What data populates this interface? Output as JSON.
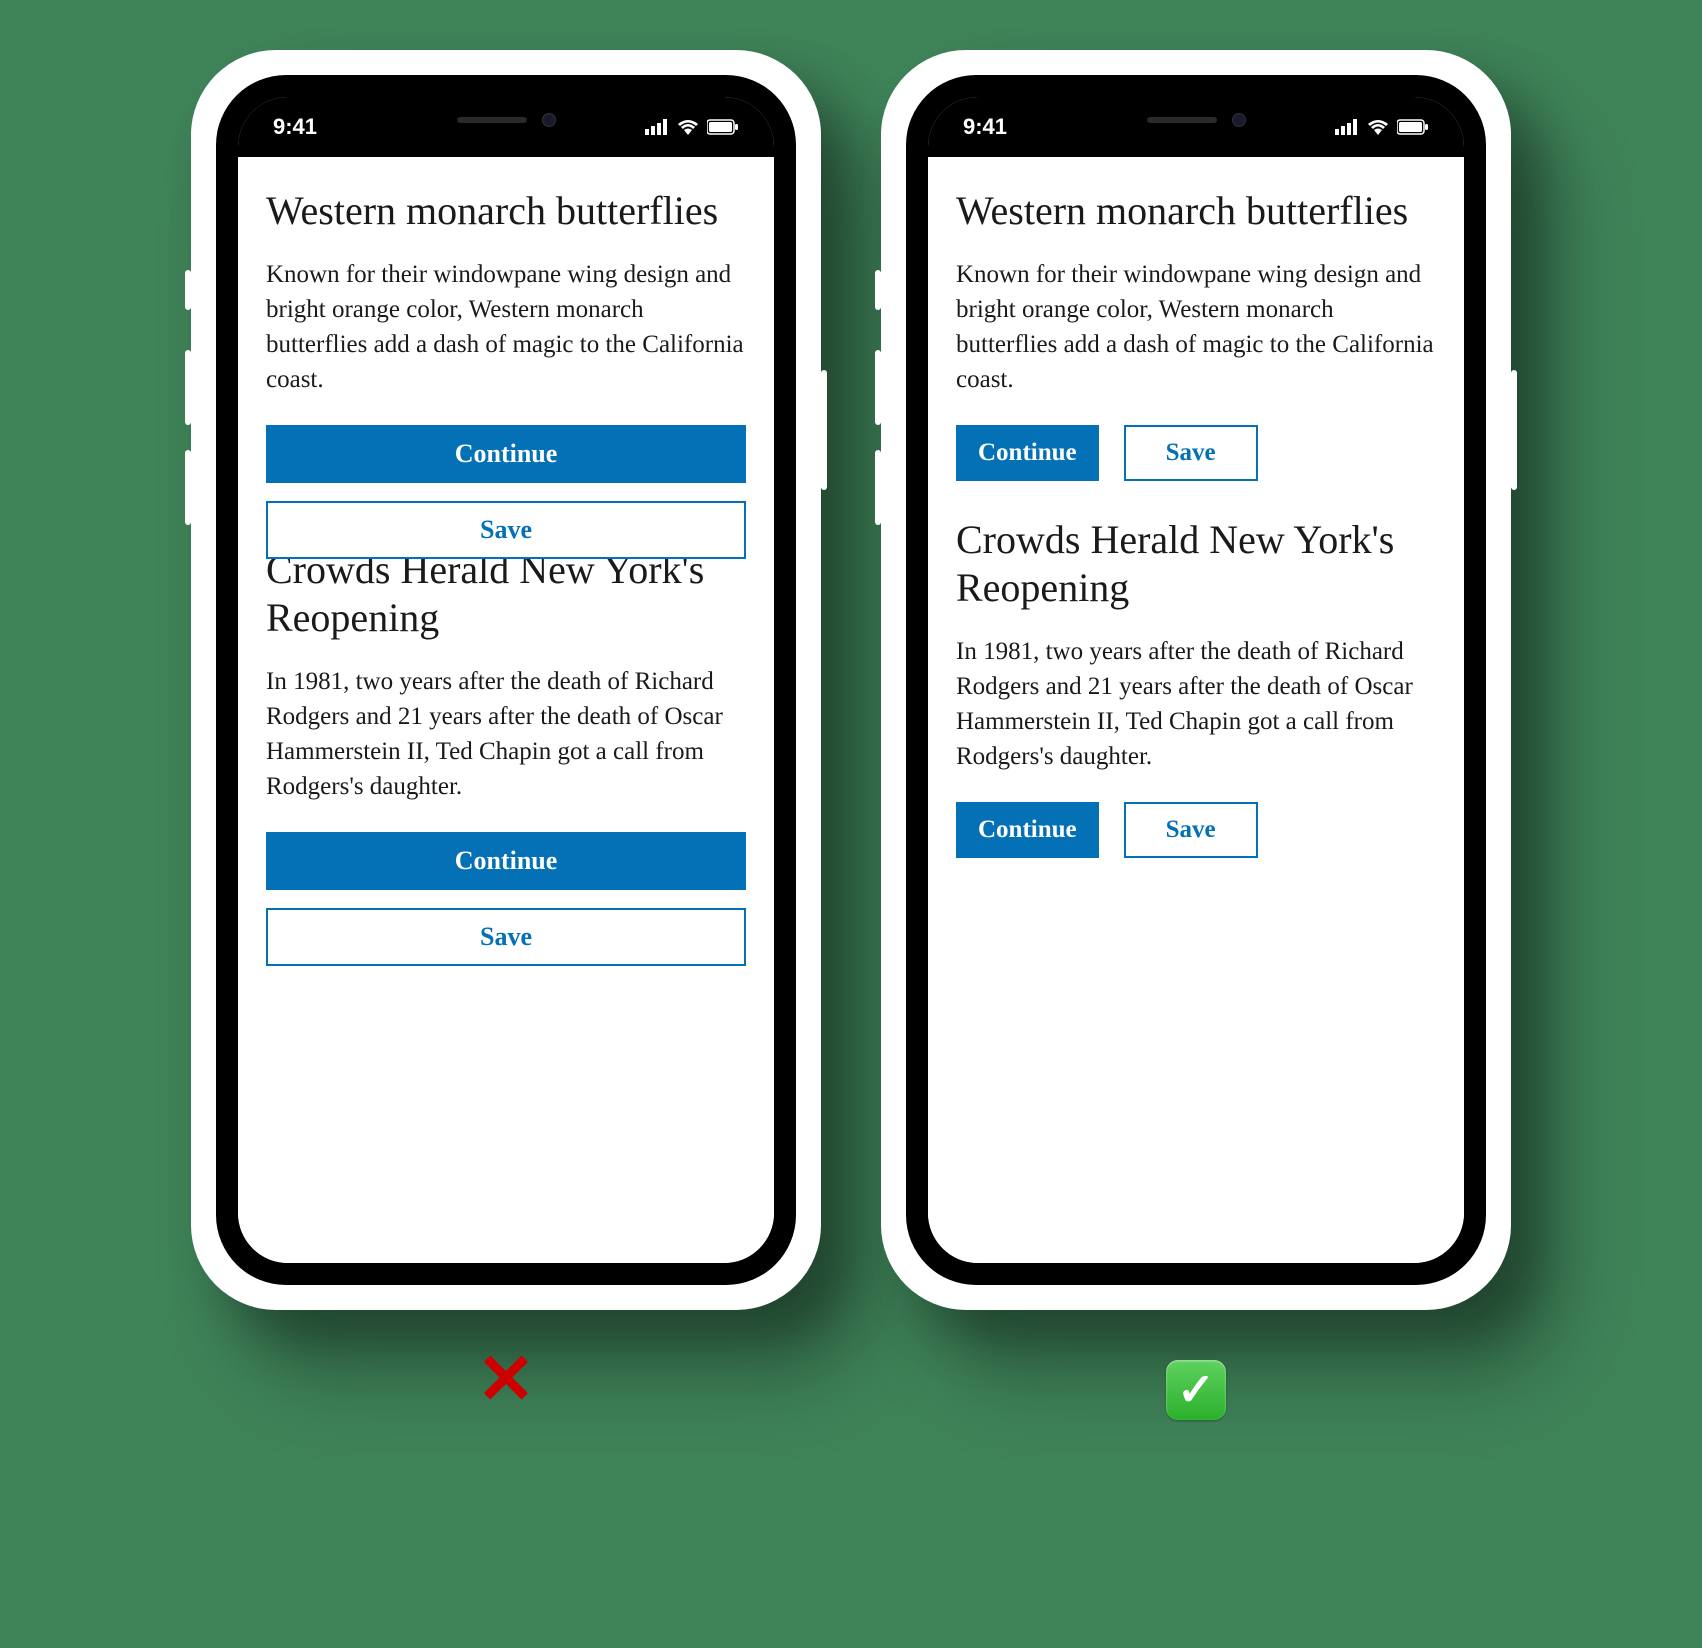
{
  "status": {
    "time": "9:41"
  },
  "articles": [
    {
      "title": "Western monarch butterflies",
      "body": "Known for their windowpane wing design and bright orange color, Western monarch butterflies add a dash of magic to the California coast."
    },
    {
      "title": "Crowds Herald New York's Reopening",
      "body": "In 1981, two years after the death of Richard Rodgers and 21 years after the death of Oscar Hammerstein II, Ted Chapin got a call from Rodgers's daughter."
    }
  ],
  "buttons": {
    "continue": "Continue",
    "save": "Save"
  },
  "colors": {
    "background": "#3f8359",
    "primary_button": "#0470b5",
    "text": "#1a1a1a"
  },
  "verdict": {
    "bad": "✕",
    "good": "✓"
  }
}
